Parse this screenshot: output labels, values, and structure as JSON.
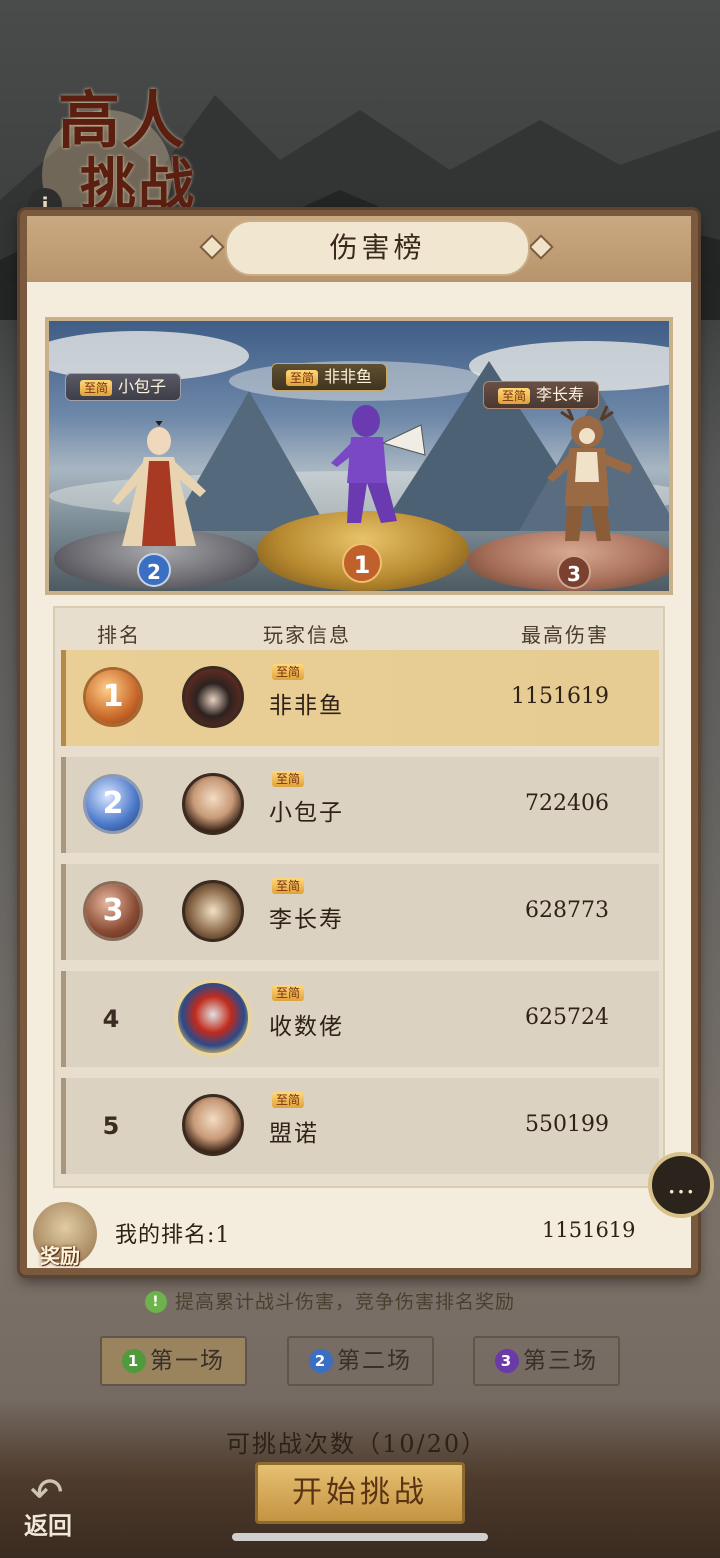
{
  "event": {
    "title_line1": "高人",
    "title_line2": "挑战",
    "info_glyph": "i"
  },
  "panel": {
    "title": "伤害榜"
  },
  "podium": [
    {
      "rank": "2",
      "vip": "至简",
      "name": "小包子"
    },
    {
      "rank": "1",
      "vip": "至简",
      "name": "非非鱼"
    },
    {
      "rank": "3",
      "vip": "至简",
      "name": "李长寿"
    }
  ],
  "table": {
    "headers": {
      "rank": "排名",
      "player": "玩家信息",
      "damage": "最高伤害"
    },
    "rows": [
      {
        "rank": "1",
        "vip": "至简",
        "name": "非非鱼",
        "damage": "1151619"
      },
      {
        "rank": "2",
        "vip": "至简",
        "name": "小包子",
        "damage": "722406"
      },
      {
        "rank": "3",
        "vip": "至简",
        "name": "李长寿",
        "damage": "628773"
      },
      {
        "rank": "4",
        "vip": "至简",
        "name": "收数佬",
        "damage": "625724"
      },
      {
        "rank": "5",
        "vip": "至简",
        "name": "盟诺",
        "damage": "550199"
      }
    ]
  },
  "my": {
    "reward_label": "奖励",
    "rank_text": "我的排名:1",
    "damage": "1151619"
  },
  "chat_glyph": "…",
  "tip": "提高累计战斗伤害，竞争伤害排名奖励",
  "tip_icon": "!",
  "tabs": [
    {
      "num": "1",
      "label": "第一场",
      "color": "#4f9a3a"
    },
    {
      "num": "2",
      "label": "第二场",
      "color": "#3a6fc4"
    },
    {
      "num": "3",
      "label": "第三场",
      "color": "#6a3aa8"
    }
  ],
  "attempts": "可挑战次数（10/20）",
  "start_button": "开始挑战",
  "back_label": "返回",
  "back_arrow": "↶"
}
